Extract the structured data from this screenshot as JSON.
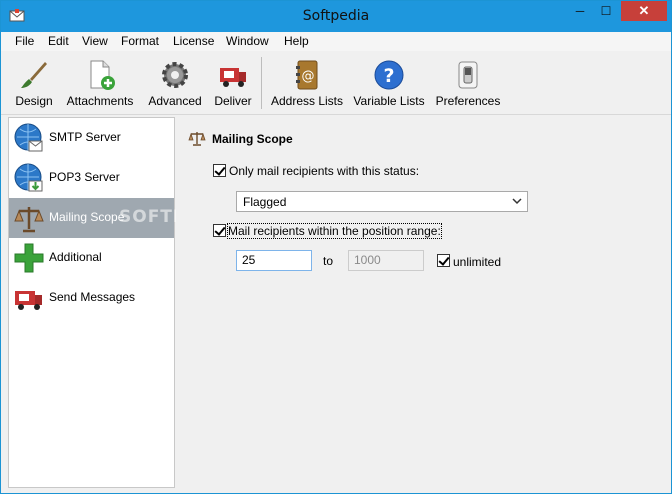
{
  "window": {
    "title": "Softpedia",
    "minimize_glyph": "─",
    "maximize_glyph": "☐",
    "close_glyph": "✕"
  },
  "menu": [
    "File",
    "Edit",
    "View",
    "Format",
    "License",
    "Window",
    "Help"
  ],
  "toolbar": [
    {
      "label": "Design",
      "icon": "paintbrush-icon"
    },
    {
      "label": "Attachments",
      "icon": "attachment-document-icon"
    },
    {
      "label": "Advanced",
      "icon": "gear-icon"
    },
    {
      "label": "Deliver",
      "icon": "mail-truck-icon"
    },
    {
      "label": "Address Lists",
      "icon": "address-book-icon"
    },
    {
      "label": "Variable Lists",
      "icon": "help-question-icon"
    },
    {
      "label": "Preferences",
      "icon": "switch-icon"
    }
  ],
  "sidebar": [
    {
      "label": "SMTP Server",
      "icon": "globe-mail-icon",
      "selected": false
    },
    {
      "label": "POP3 Server",
      "icon": "globe-download-icon",
      "selected": false
    },
    {
      "label": "Mailing Scope",
      "icon": "scales-icon",
      "selected": true
    },
    {
      "label": "Additional",
      "icon": "plus-icon",
      "selected": false
    },
    {
      "label": "Send Messages",
      "icon": "mail-truck-icon",
      "selected": false
    }
  ],
  "watermark": "SOFTPEDIA",
  "main": {
    "section_title": "Mailing Scope",
    "status_checkbox_label": "Only mail recipients with this status:",
    "status_checked": true,
    "status_value": "Flagged",
    "position_checkbox_label": "Mail recipients within the position range:",
    "position_checked": true,
    "from_value": "25",
    "to_label": "to",
    "to_value": "1000",
    "unlimited_label": "unlimited",
    "unlimited_checked": true
  },
  "colors": {
    "titlebar": "#1e97dd",
    "close": "#c7403a",
    "selected_item": "#9fa8b0"
  }
}
